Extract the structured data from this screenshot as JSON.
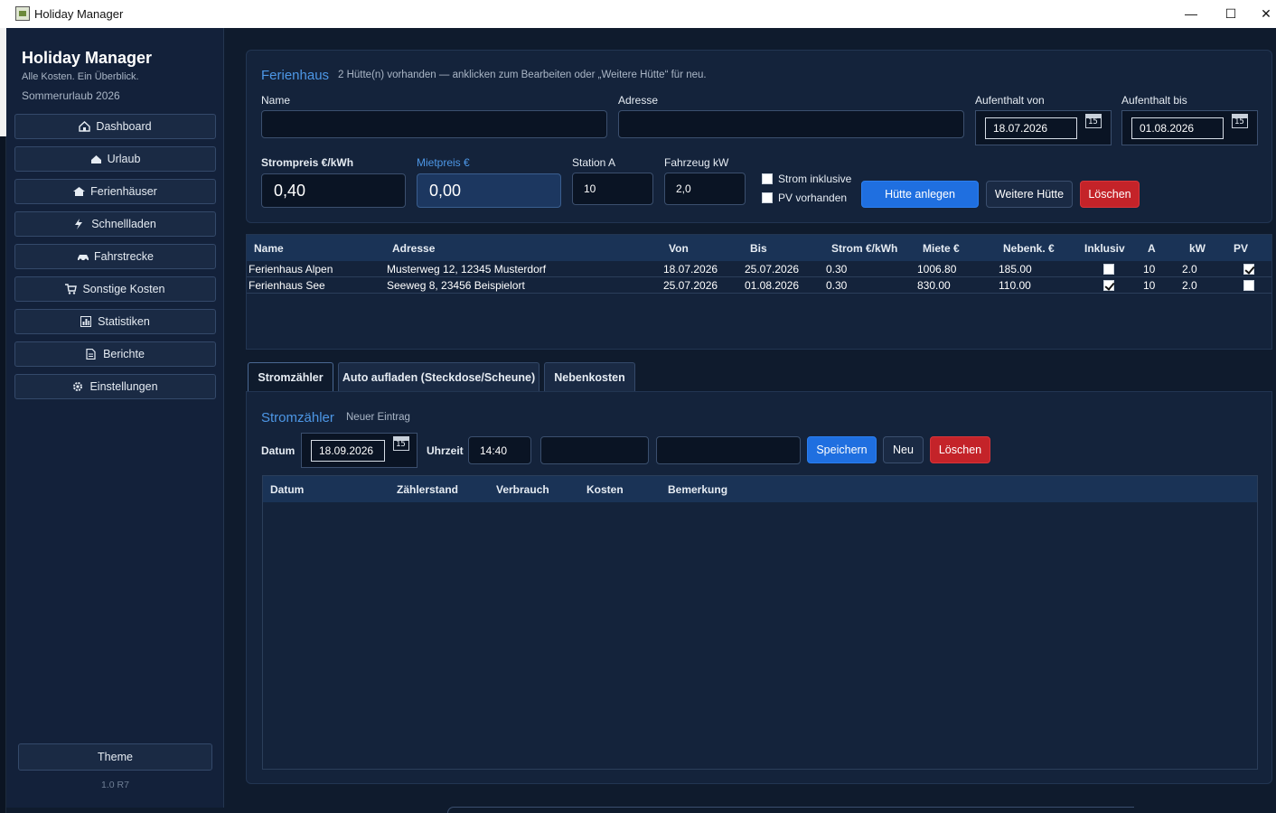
{
  "window": {
    "title": "Holiday Manager"
  },
  "sidebar": {
    "title": "Holiday Manager",
    "subtitle": "Alle Kosten. Ein Überblick.",
    "trip": "Sommerurlaub 2026",
    "items": [
      {
        "label": "Dashboard",
        "icon": "house-icon"
      },
      {
        "label": "Urlaub",
        "icon": "sun-house-icon"
      },
      {
        "label": "Ferienhäuser",
        "icon": "cabin-icon"
      },
      {
        "label": "Schnellladen",
        "icon": "lightning-icon"
      },
      {
        "label": "Fahrstrecke",
        "icon": "car-icon"
      },
      {
        "label": "Sonstige Kosten",
        "icon": "cart-icon"
      },
      {
        "label": "Statistiken",
        "icon": "chart-icon"
      },
      {
        "label": "Berichte",
        "icon": "document-icon"
      },
      {
        "label": "Einstellungen",
        "icon": "gear-icon"
      }
    ],
    "theme_label": "Theme",
    "version": "1.0 R7"
  },
  "ferienhaus": {
    "title": "Ferienhaus",
    "hint": "2 Hütte(n) vorhanden — anklicken zum Bearbeiten oder „Weitere Hütte“ für neu.",
    "name_label": "Name",
    "name_value": "",
    "address_label": "Adresse",
    "address_value": "",
    "from_label": "Aufenthalt von",
    "from_value": "18.07.2026",
    "to_label": "Aufenthalt bis",
    "to_value": "01.08.2026",
    "calendar_day": "15",
    "strompreis_label": "Strompreis €/kWh",
    "strompreis_value": "0,40",
    "mietpreis_label": "Mietpreis €",
    "mietpreis_value": "0,00",
    "station_label": "Station A",
    "station_value": "10",
    "fahrzeug_label": "Fahrzeug kW",
    "fahrzeug_value": "2,0",
    "strom_inklusive_label": "Strom inklusive",
    "strom_inklusive": false,
    "pv_label": "PV vorhanden",
    "pv": false,
    "create_label": "Hütte anlegen",
    "more_label": "Weitere Hütte",
    "delete_label": "Löschen"
  },
  "houses_table": {
    "columns": [
      "Name",
      "Adresse",
      "Von",
      "Bis",
      "Strom €/kWh",
      "Miete €",
      "Nebenk. €",
      "Inklusiv",
      "A",
      "kW",
      "PV"
    ],
    "rows": [
      {
        "name": "Ferienhaus Alpen",
        "address": "Musterweg 12, 12345 Musterdorf",
        "von": "18.07.2026",
        "bis": "25.07.2026",
        "strom": "0.30",
        "miete": "1006.80",
        "nebenk": "185.00",
        "inklusiv": false,
        "a": "10",
        "kw": "2.0",
        "pv": true
      },
      {
        "name": "Ferienhaus See",
        "address": "Seeweg 8, 23456 Beispielort",
        "von": "25.07.2026",
        "bis": "01.08.2026",
        "strom": "0.30",
        "miete": "830.00",
        "nebenk": "110.00",
        "inklusiv": true,
        "a": "10",
        "kw": "2.0",
        "pv": false
      }
    ]
  },
  "tabs": [
    {
      "label": "Stromzähler",
      "active": true
    },
    {
      "label": "Auto aufladen (Steckdose/Scheune)",
      "active": false
    },
    {
      "label": "Nebenkosten",
      "active": false
    }
  ],
  "stromzaehler": {
    "title": "Stromzähler",
    "subtitle": "Neuer Eintrag",
    "datum_label": "Datum",
    "datum_value": "18.09.2026",
    "uhrzeit_label": "Uhrzeit",
    "uhrzeit_value": "14:40",
    "zaehlerstand_value": "",
    "bemerkung_value": "",
    "save_label": "Speichern",
    "new_label": "Neu",
    "delete_label": "Löschen",
    "columns": [
      "Datum",
      "Zählerstand",
      "Verbrauch",
      "Kosten",
      "Bemerkung"
    ]
  },
  "colors": {
    "accent": "#1f6fe0",
    "title_blue": "#4d97e6",
    "danger": "#c42329",
    "background": "#0f1b2d",
    "panel": "#14233b"
  }
}
